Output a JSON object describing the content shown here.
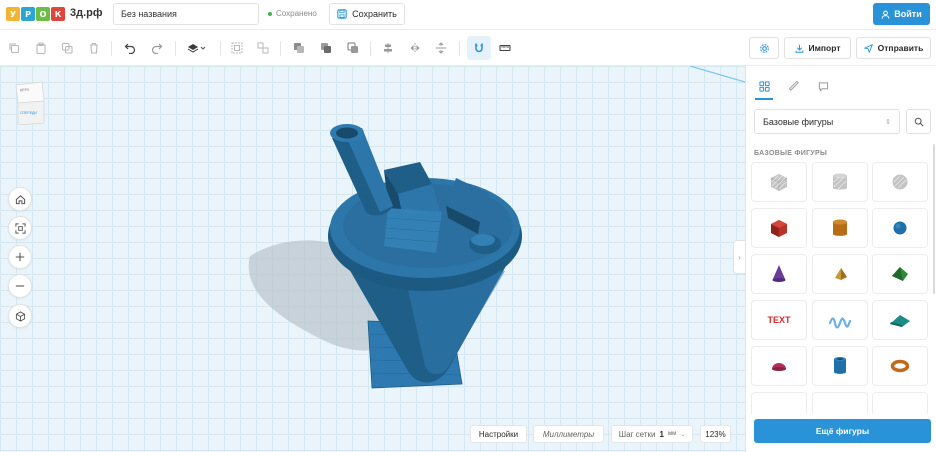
{
  "logo": {
    "letters": [
      "У",
      "Р",
      "О",
      "К"
    ],
    "letter_colors": [
      "#f2b531",
      "#2ba5d4",
      "#6bbd45",
      "#e0453a"
    ],
    "domain": "3д.рф"
  },
  "header": {
    "project_title": "Без названия",
    "save_status": "Сохранено",
    "save_label": "Сохранить",
    "login_label": "Войти"
  },
  "toolbar": {
    "icons": [
      "copy-icon",
      "paste-icon",
      "duplicate-icon",
      "delete-icon",
      "undo-icon",
      "redo-icon",
      "workplane-icon",
      "group-icon",
      "ungroup-icon",
      "hole-icon",
      "union-icon",
      "subtract-icon",
      "align-icon",
      "mirror-icon",
      "flip-icon",
      "magnet-icon",
      "ruler-icon"
    ],
    "import_label": "Импорт",
    "send_label": "Отправить"
  },
  "canvas": {
    "viewcube_top_label": "ВЕРХ",
    "viewcube_front_label": "СПЕРЕДИ",
    "settings_label": "Настройки",
    "units_label": "Миллиметры",
    "grid_step_label": "Шаг сетки",
    "grid_step_value": "1",
    "grid_step_unit": "мм",
    "zoom_label": "123%"
  },
  "panel": {
    "tabs": [
      "shapes-tab",
      "ruler-tab",
      "comments-tab"
    ],
    "category": "Базовые фигуры",
    "section_title": "БАЗОВЫЕ ФИГУРЫ",
    "shapes": [
      {
        "name": "box-hole",
        "color": "#b5b5b5"
      },
      {
        "name": "cylinder-hole",
        "color": "#b5b5b5"
      },
      {
        "name": "sphere-hole",
        "color": "#b5b5b5"
      },
      {
        "name": "box",
        "color": "#c0392b"
      },
      {
        "name": "cylinder",
        "color": "#c77a1e"
      },
      {
        "name": "sphere",
        "color": "#1f6fa8"
      },
      {
        "name": "cone",
        "color": "#6a3c9a"
      },
      {
        "name": "pyramid",
        "color": "#b5862a"
      },
      {
        "name": "roof",
        "color": "#2f8a3a"
      },
      {
        "name": "text",
        "color": "#d22b2b",
        "label": "TEXT"
      },
      {
        "name": "scribble",
        "color": "#6fb0e0"
      },
      {
        "name": "wedge",
        "color": "#1c8a87"
      },
      {
        "name": "half-sphere",
        "color": "#b0325a"
      },
      {
        "name": "tube",
        "color": "#1f6fa8"
      },
      {
        "name": "torus",
        "color": "#c06a1e"
      }
    ],
    "more_label": "Ещё фигуры"
  },
  "colors": {
    "accent": "#2a93d8",
    "model": "#1f5f87",
    "grid_bg": "#eaf4fb"
  }
}
